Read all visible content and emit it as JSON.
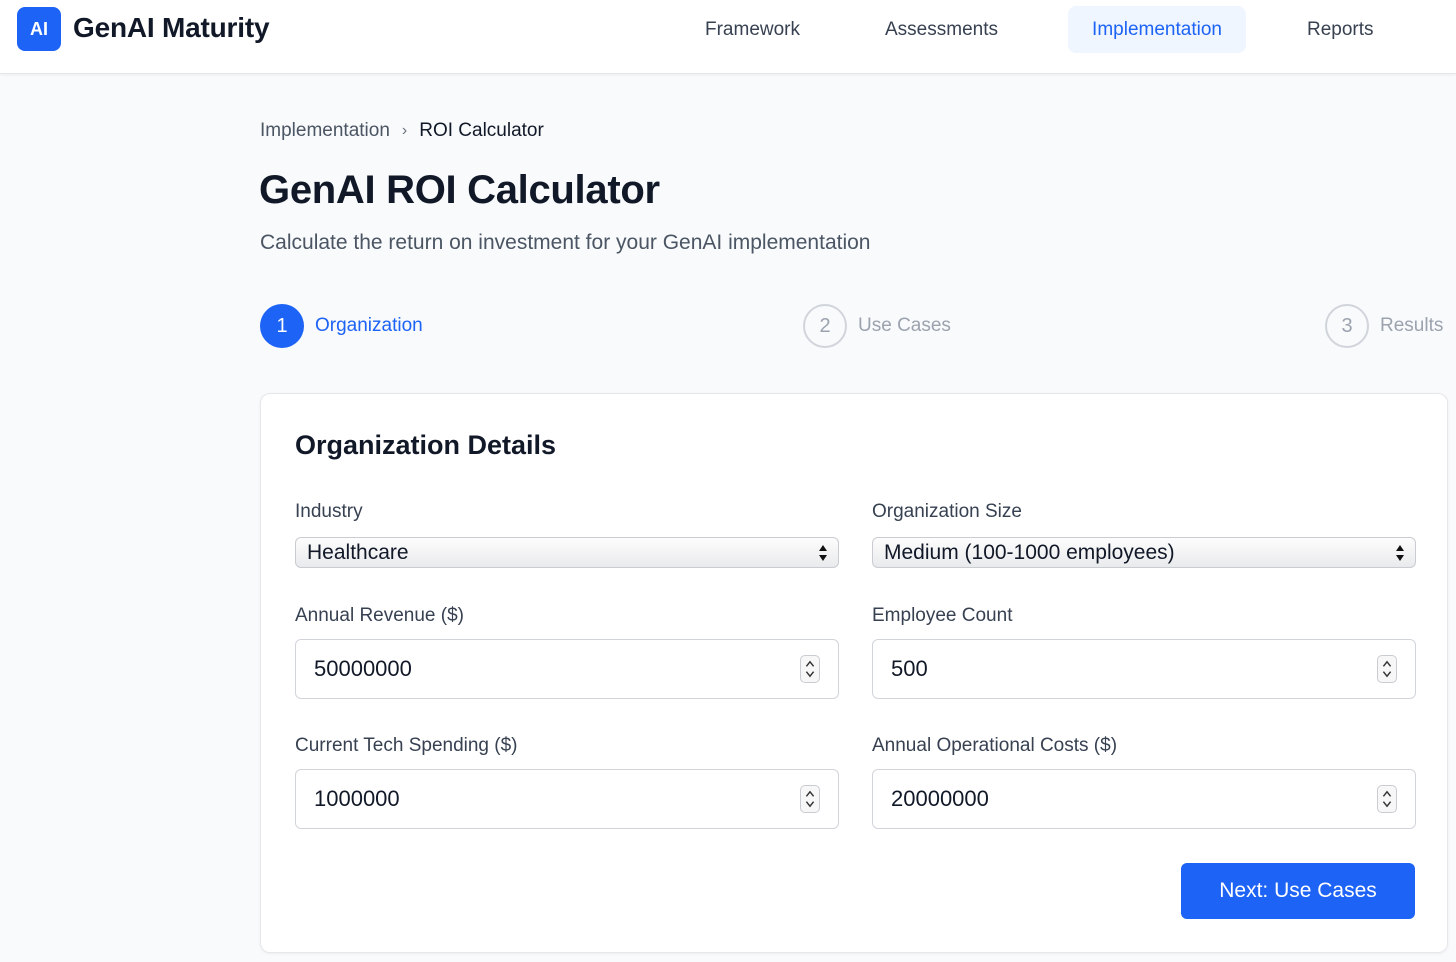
{
  "header": {
    "logo_text": "AI",
    "app_title": "GenAI Maturity",
    "nav": [
      {
        "label": "Framework",
        "active": false
      },
      {
        "label": "Assessments",
        "active": false
      },
      {
        "label": "Implementation",
        "active": true
      },
      {
        "label": "Reports",
        "active": false
      }
    ]
  },
  "breadcrumb": {
    "parent": "Implementation",
    "separator": "›",
    "current": "ROI Calculator"
  },
  "page": {
    "title": "GenAI ROI Calculator",
    "subtitle": "Calculate the return on investment for your GenAI implementation"
  },
  "stepper": [
    {
      "number": "1",
      "label": "Organization",
      "active": true
    },
    {
      "number": "2",
      "label": "Use Cases",
      "active": false
    },
    {
      "number": "3",
      "label": "Results",
      "active": false
    }
  ],
  "card": {
    "title": "Organization Details",
    "fields": {
      "industry": {
        "label": "Industry",
        "value": "Healthcare"
      },
      "org_size": {
        "label": "Organization Size",
        "value": "Medium (100-1000 employees)"
      },
      "annual_revenue": {
        "label": "Annual Revenue ($)",
        "value": "50000000"
      },
      "employee_count": {
        "label": "Employee Count",
        "value": "500"
      },
      "tech_spending": {
        "label": "Current Tech Spending ($)",
        "value": "1000000"
      },
      "operational_costs": {
        "label": "Annual Operational Costs ($)",
        "value": "20000000"
      }
    },
    "next_button": "Next: Use Cases"
  },
  "colors": {
    "accent": "#1d63f5",
    "nav_active_bg": "#eff6ff",
    "page_bg": "#f8fafc"
  }
}
